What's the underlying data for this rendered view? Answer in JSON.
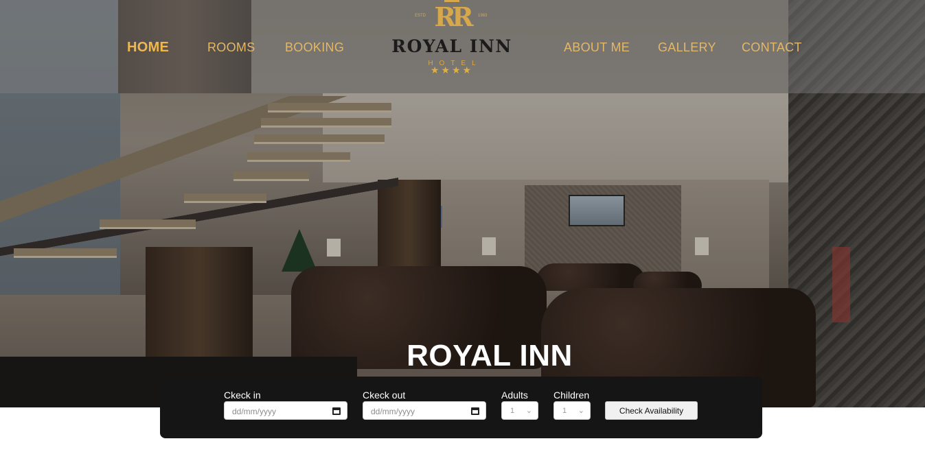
{
  "nav": {
    "left_links": [
      "HOME",
      "ROOMS",
      "BOOKING"
    ],
    "right_links": [
      "ABOUT ME",
      "GALLERY",
      "CONTACT"
    ],
    "active": "HOME"
  },
  "logo": {
    "monogram": "RR",
    "estd_left": "ESTD",
    "estd_right": "1983",
    "name": "ROYAL INN",
    "subtitle": "HOTEL",
    "stars": "★★★★"
  },
  "hero": {
    "title": "ROYAL INN"
  },
  "booking": {
    "checkin_label": "Ckeck in",
    "checkin_placeholder": "dd/mm/yyyy",
    "checkout_label": "Ckeck out",
    "checkout_placeholder": "dd/mm/yyyy",
    "adults_label": "Adults",
    "adults_value": "1",
    "children_label": "Children",
    "children_value": "1",
    "button_label": "Check Availability",
    "calendar_icon": "calendar-icon",
    "chevron_icon": "chevron-down-icon"
  },
  "colors": {
    "accent_gold": "#e3b867",
    "booking_bg": "#151515",
    "title_white": "#ffffff"
  }
}
